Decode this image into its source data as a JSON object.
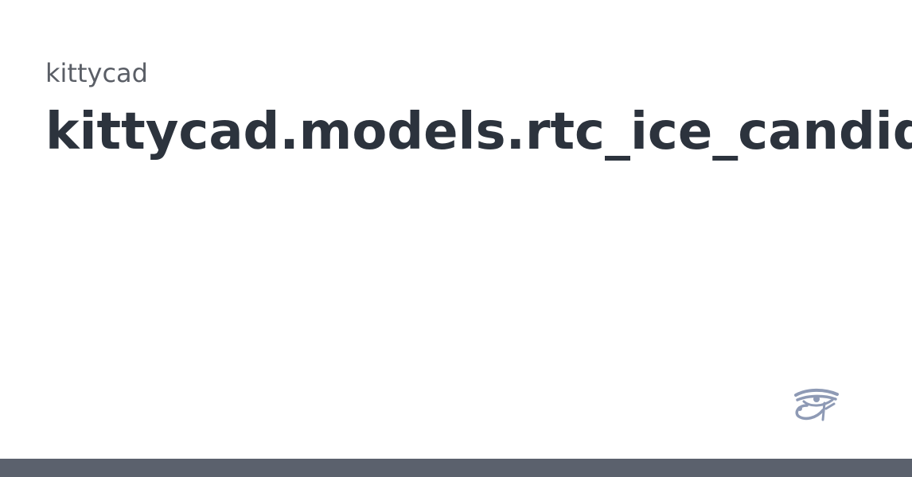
{
  "card": {
    "org_name": "kittycad",
    "title": "kittycad.models.rtc_ice_candidate",
    "logo_icon": "eye-of-horus-icon",
    "colors": {
      "org_text": "#5a5e66",
      "title_text": "#2c333d",
      "logo": "#8e9ab5",
      "bottom_bar": "#5b616d"
    }
  }
}
